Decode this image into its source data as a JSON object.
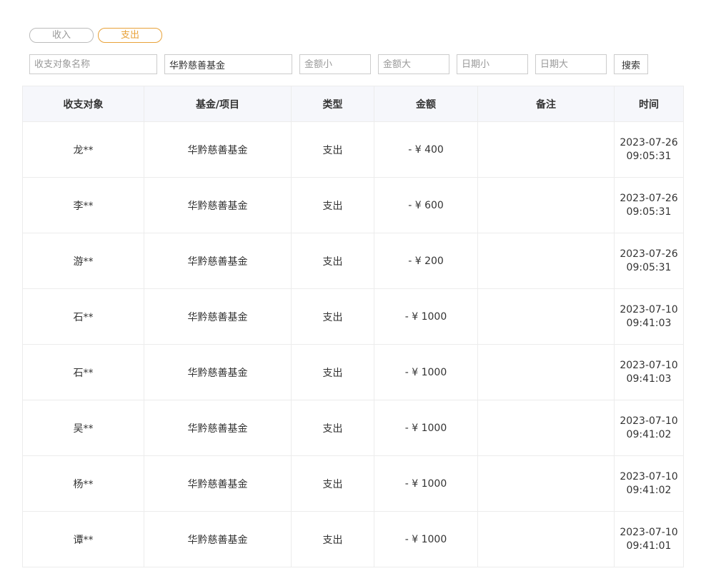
{
  "tabs": {
    "income": "收入",
    "expense": "支出",
    "active": "expense"
  },
  "filters": {
    "counterparty_placeholder": "收支对象名称",
    "fund_value": "华黔慈善基金",
    "amount_min_placeholder": "金额小",
    "amount_max_placeholder": "金额大",
    "date_min_placeholder": "日期小",
    "date_max_placeholder": "日期大",
    "search_label": "搜索"
  },
  "table": {
    "headers": [
      "收支对象",
      "基金/项目",
      "类型",
      "金额",
      "备注",
      "时间"
    ],
    "rows": [
      {
        "counterparty": "龙**",
        "fund": "华黔慈善基金",
        "type": "支出",
        "amount": "- ¥ 400",
        "note": "",
        "time": "2023-07-26 09:05:31"
      },
      {
        "counterparty": "李**",
        "fund": "华黔慈善基金",
        "type": "支出",
        "amount": "- ¥ 600",
        "note": "",
        "time": "2023-07-26 09:05:31"
      },
      {
        "counterparty": "游**",
        "fund": "华黔慈善基金",
        "type": "支出",
        "amount": "- ¥ 200",
        "note": "",
        "time": "2023-07-26 09:05:31"
      },
      {
        "counterparty": "石**",
        "fund": "华黔慈善基金",
        "type": "支出",
        "amount": "- ¥ 1000",
        "note": "",
        "time": "2023-07-10 09:41:03"
      },
      {
        "counterparty": "石**",
        "fund": "华黔慈善基金",
        "type": "支出",
        "amount": "- ¥ 1000",
        "note": "",
        "time": "2023-07-10 09:41:03"
      },
      {
        "counterparty": "吴**",
        "fund": "华黔慈善基金",
        "type": "支出",
        "amount": "- ¥ 1000",
        "note": "",
        "time": "2023-07-10 09:41:02"
      },
      {
        "counterparty": "杨**",
        "fund": "华黔慈善基金",
        "type": "支出",
        "amount": "- ¥ 1000",
        "note": "",
        "time": "2023-07-10 09:41:02"
      },
      {
        "counterparty": "谭**",
        "fund": "华黔慈善基金",
        "type": "支出",
        "amount": "- ¥ 1000",
        "note": "",
        "time": "2023-07-10 09:41:01"
      }
    ]
  },
  "colors": {
    "accent": "#e8a23a",
    "amount": "#4dbfa0",
    "header_bg": "#f6f7fb",
    "border": "#ececec"
  }
}
